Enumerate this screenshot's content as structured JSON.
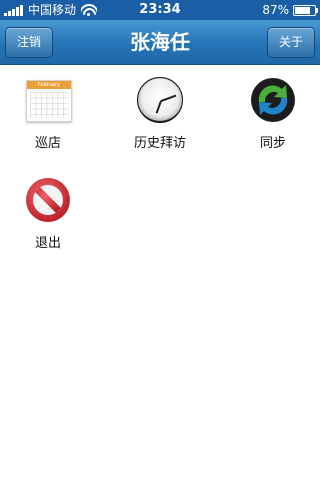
{
  "status_bar": {
    "carrier": "中国移动",
    "time": "23:34",
    "battery": "87%",
    "battery_level": 0.87,
    "signal_bars": 5
  },
  "nav": {
    "title": "张海任",
    "left_button": "注销",
    "right_button": "关于"
  },
  "menu": {
    "items": [
      {
        "label": "巡店",
        "icon": "calendar-icon"
      },
      {
        "label": "历史拜访",
        "icon": "clock-icon"
      },
      {
        "label": "同步",
        "icon": "sync-icon"
      },
      {
        "label": "退出",
        "icon": "no-entry-icon"
      }
    ]
  },
  "calendar_icon_text": "February",
  "colors": {
    "nav_blue": "#2574b7",
    "status_bar": "#1a5fa6",
    "exit_red": "#c9262e",
    "sync_green": "#4bb03b",
    "sync_blue": "#1f84c9"
  }
}
